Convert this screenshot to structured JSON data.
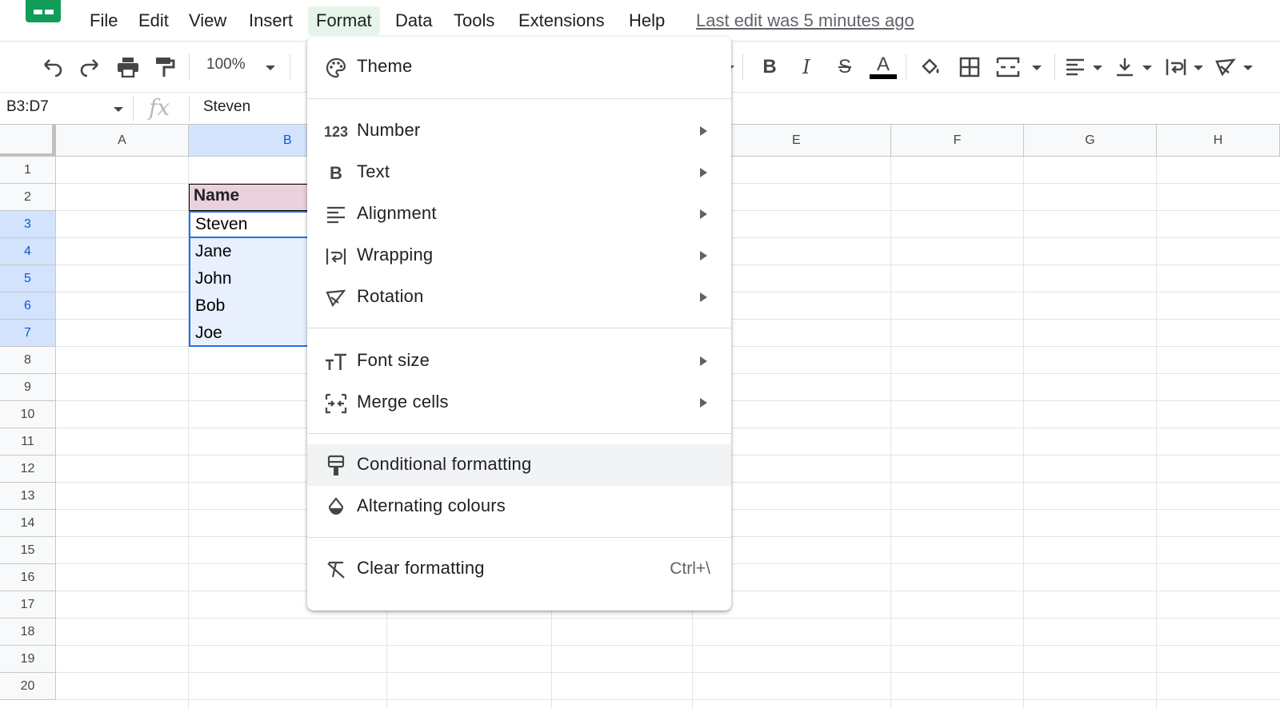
{
  "menubar": {
    "items": [
      "File",
      "Edit",
      "View",
      "Insert",
      "Format",
      "Data",
      "Tools",
      "Extensions",
      "Help"
    ],
    "active": "Format",
    "last_edit": "Last edit was 5 minutes ago"
  },
  "toolbar": {
    "zoom": "100%"
  },
  "formula_bar": {
    "name_box": "B3:D7",
    "fx_label": "fx",
    "value": "Steven"
  },
  "grid": {
    "columns": [
      "A",
      "B",
      "E",
      "F",
      "G",
      "H"
    ],
    "rows": [
      "1",
      "2",
      "3",
      "4",
      "5",
      "6",
      "7",
      "8",
      "9",
      "10",
      "11",
      "12",
      "13",
      "14",
      "15",
      "16",
      "17",
      "18",
      "19",
      "20"
    ],
    "header_cell": "Name",
    "cells": [
      "Steven",
      "Jane",
      "John",
      "Bob",
      "Joe"
    ]
  },
  "format_menu": {
    "items": {
      "theme": "Theme",
      "number": "Number",
      "text": "Text",
      "alignment": "Alignment",
      "wrapping": "Wrapping",
      "rotation": "Rotation",
      "font_size": "Font size",
      "merge_cells": "Merge cells",
      "conditional_formatting": "Conditional formatting",
      "alternating_colours": "Alternating colours",
      "clear_formatting": "Clear formatting"
    },
    "number_icon_text": "123",
    "clear_shortcut": "Ctrl+\\",
    "highlighted": "Conditional formatting"
  },
  "colors": {
    "brand_green": "#0f9d58",
    "menu_active_bg": "#e6f4ea",
    "selection_border": "#1a73e8",
    "selection_fill": "#e8f0fe",
    "header_fill": "#ead1dc"
  }
}
